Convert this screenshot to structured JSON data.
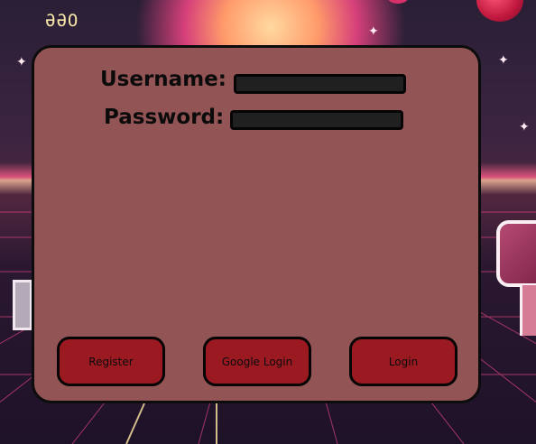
{
  "background": {
    "logo_text": "ƏƏO",
    "sparkles": [
      "✦",
      "✦",
      "✦",
      "✦"
    ]
  },
  "login_form": {
    "username_label": "Username:",
    "username_value": "",
    "password_label": "Password:",
    "password_value": ""
  },
  "buttons": {
    "register_label": "Register",
    "google_login_label": "Google Login",
    "login_label": "Login"
  },
  "colors": {
    "card_bg": "#935455",
    "button_bg": "#9b1a22",
    "field_bg": "#202020"
  }
}
